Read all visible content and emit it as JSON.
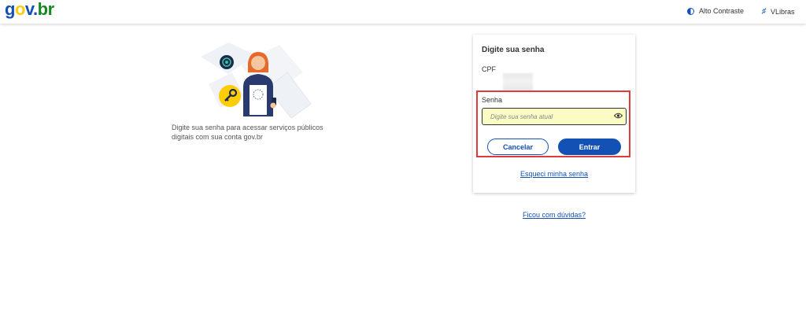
{
  "header": {
    "logo": {
      "part1": "g",
      "part2": "o",
      "part3": "v.",
      "part4": "br"
    },
    "contrast_label": "Alto Contraste",
    "libras_label": "VLibras"
  },
  "intro": {
    "text": "Digite sua senha para acessar serviços públicos digitais com sua conta gov.br"
  },
  "login": {
    "title": "Digite sua senha",
    "cpf_label": "CPF",
    "password_label": "Senha",
    "password_placeholder": "Digite sua senha atual",
    "password_value": "",
    "cancel_label": "Cancelar",
    "submit_label": "Entrar",
    "forgot_label": "Esqueci minha senha"
  },
  "help": {
    "doubt_label": "Ficou com dúvidas?"
  },
  "colors": {
    "brand_blue": "#1351b4",
    "brand_yellow": "#ffcd07",
    "brand_green": "#168821",
    "highlight_red": "#e03a3a",
    "input_bg": "#fbfbc4"
  },
  "icons": {
    "contrast": "contrast-icon",
    "libras": "hand-sign-icon",
    "eye": "eye-icon",
    "key": "key-icon",
    "fingerprint": "fingerprint-icon"
  }
}
